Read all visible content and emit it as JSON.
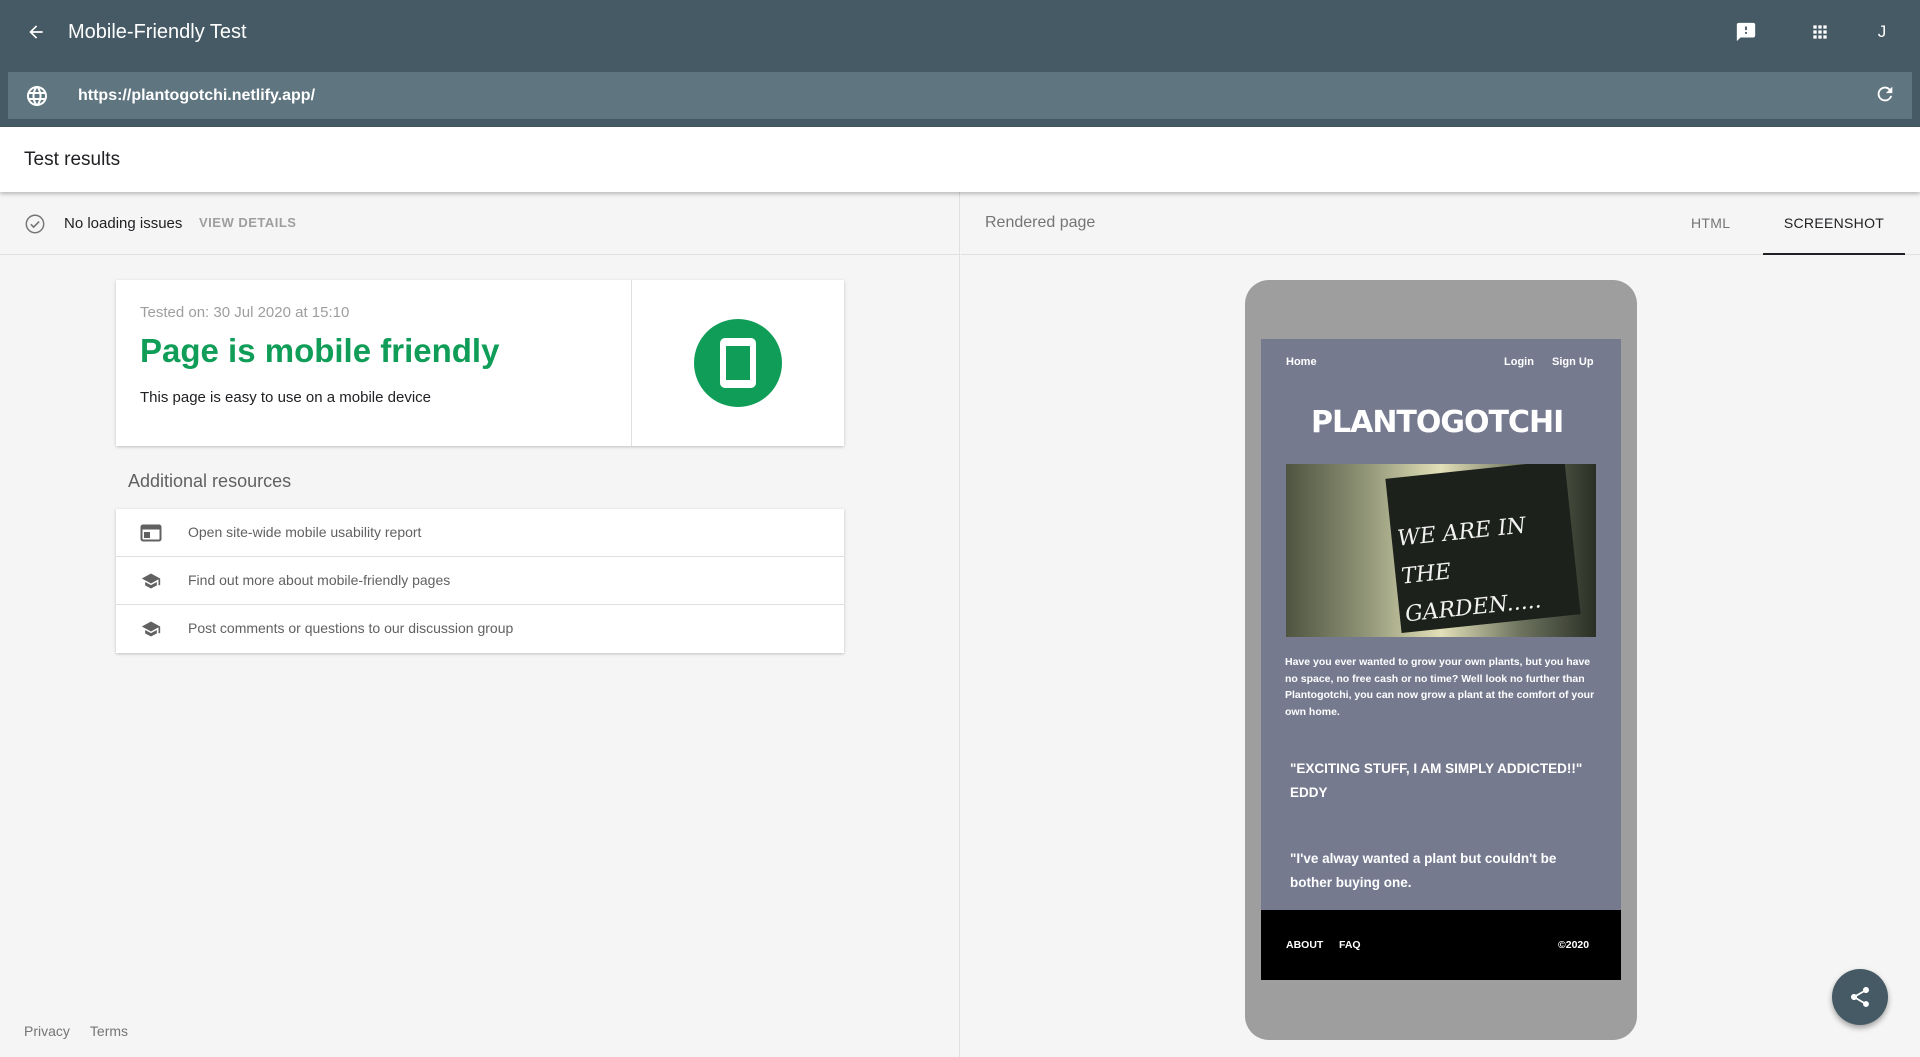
{
  "header": {
    "title": "Mobile-Friendly Test",
    "avatar_initial": "J",
    "colors": {
      "bar": "#455a64",
      "url_bar": "#5f7580"
    }
  },
  "urlbar": {
    "value": "https://plantogotchi.netlify.app/"
  },
  "results": {
    "title": "Test results"
  },
  "status": {
    "text": "No loading issues",
    "view_details": "VIEW DETAILS"
  },
  "summary": {
    "tested_on": "Tested on: 30 Jul 2020 at 15:10",
    "verdict": "Page is mobile friendly",
    "description": "This page is easy to use on a mobile device",
    "accent": "#0f9d58"
  },
  "additional": {
    "title": "Additional resources",
    "items": [
      {
        "label": "Open site-wide mobile usability report",
        "icon": "web-icon"
      },
      {
        "label": "Find out more about mobile-friendly pages",
        "icon": "school-icon"
      },
      {
        "label": "Post comments or questions to our discussion group",
        "icon": "school-icon"
      }
    ]
  },
  "footer": {
    "privacy": "Privacy",
    "terms": "Terms"
  },
  "rendered": {
    "label": "Rendered page",
    "tabs": [
      {
        "label": "HTML"
      },
      {
        "label": "SCREENSHOT",
        "selected": true
      }
    ]
  },
  "site": {
    "nav": {
      "home": "Home",
      "login": "Login",
      "signup": "Sign Up"
    },
    "logo": "PLANTOGOTCHI",
    "photo_text": "WE ARE IN THE GARDEN.....",
    "intro": "Have you ever wanted to grow your own plants, but you have no space, no free cash or no time? Well look no further than Plantogotchi, you can now grow a plant at the comfort of your own home.",
    "quote1": "\"EXCITING STUFF, I AM SIMPLY ADDICTED!!\"",
    "quote1_author": "EDDY",
    "quote2": "\"I've alway wanted a plant but couldn't be bother buying one.",
    "footer": {
      "about": "ABOUT",
      "faq": "FAQ",
      "copyright": "©2020"
    },
    "bg_color": "#757a8f"
  }
}
